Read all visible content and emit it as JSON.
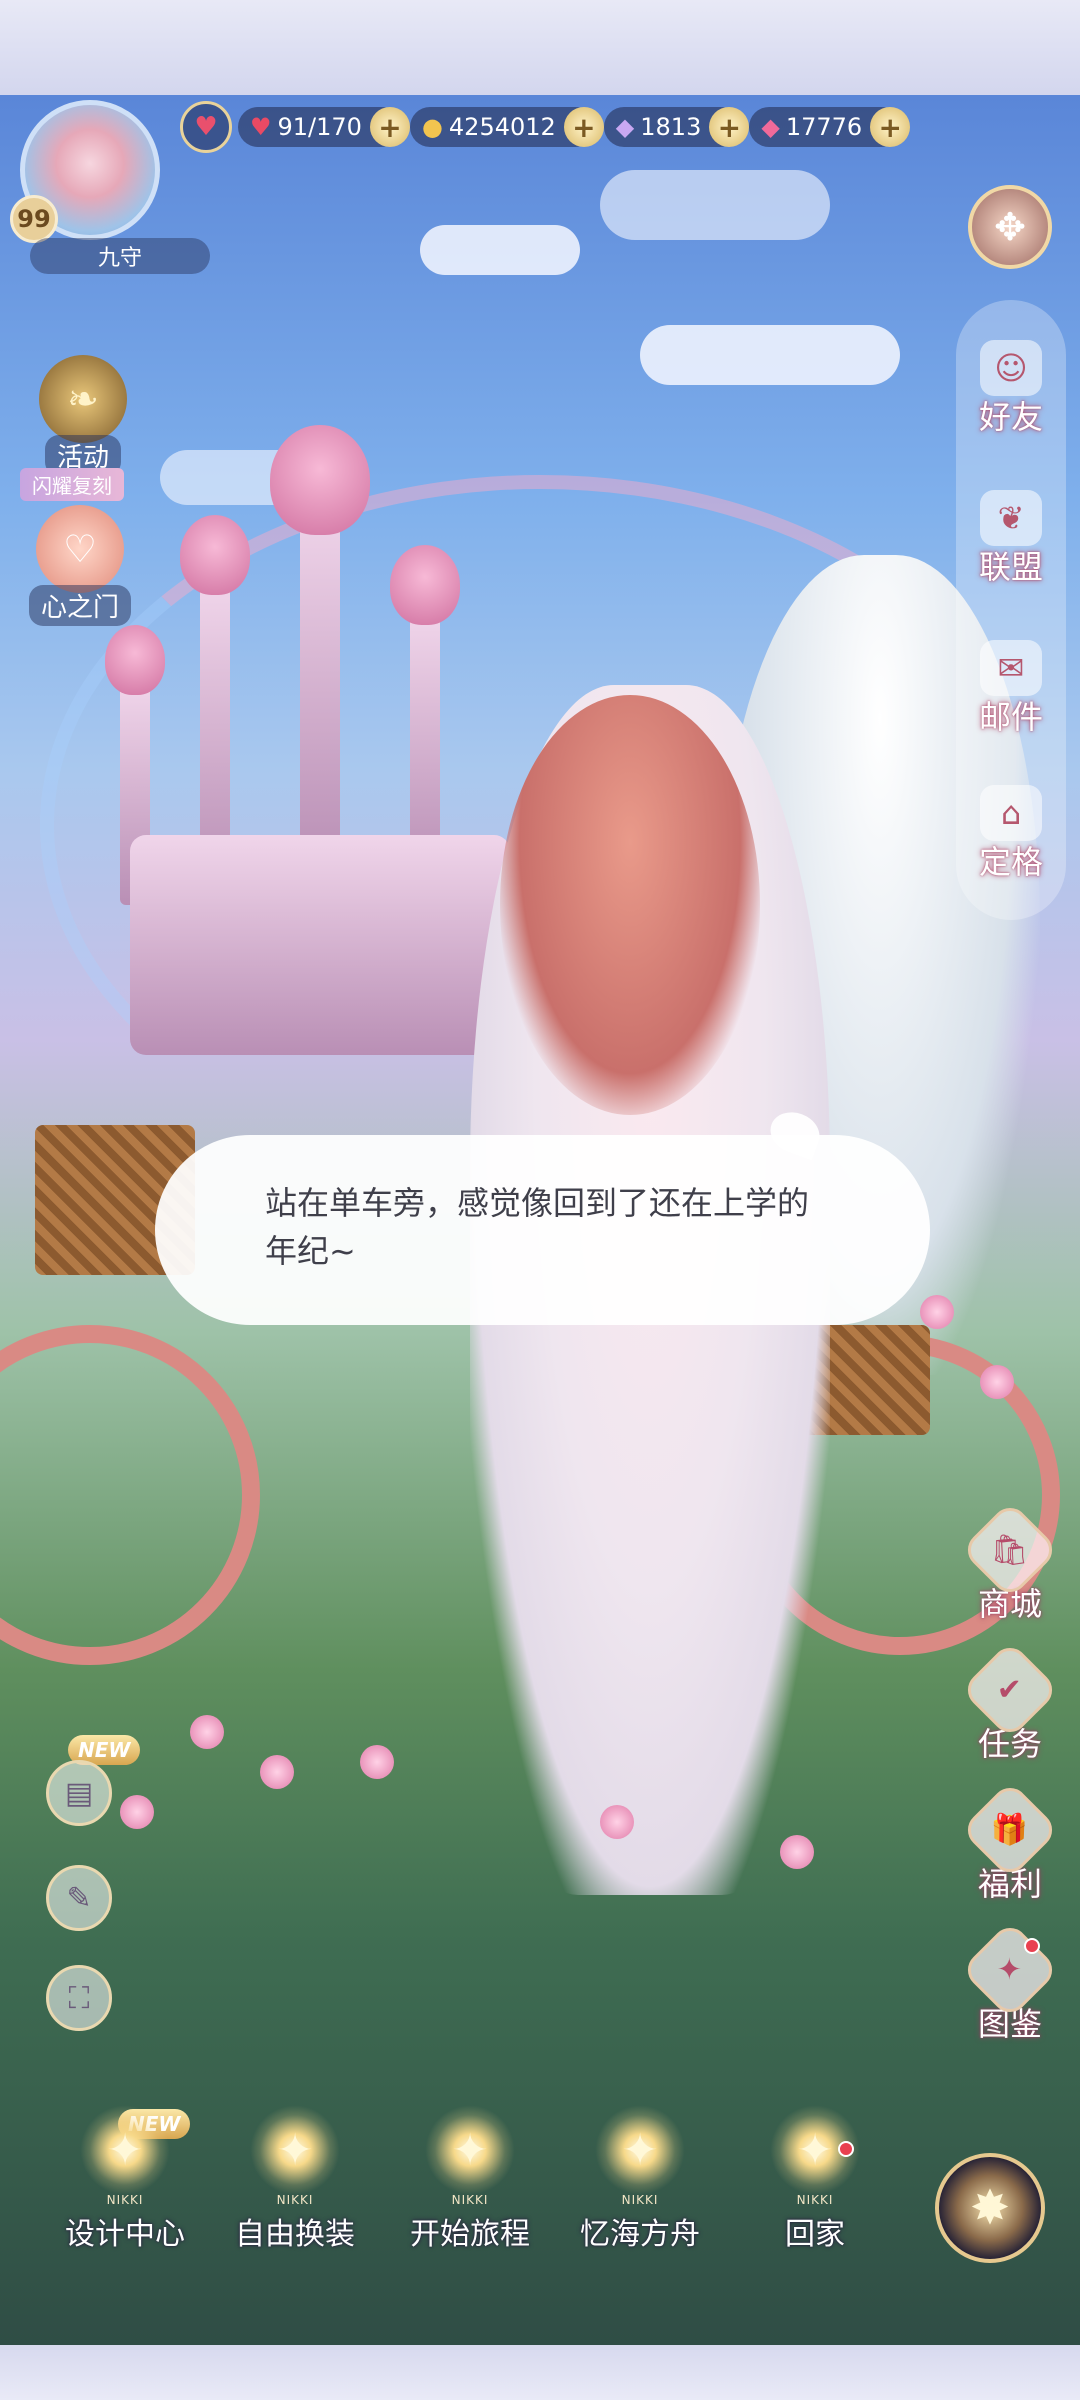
{
  "player": {
    "level": "99",
    "name": "九守"
  },
  "resources": {
    "stamina": "91/170",
    "gold": "4254012",
    "diamonds": "1813",
    "stars": "17776",
    "plus": "+"
  },
  "left_events": {
    "activity": "活动",
    "flash_tag": "闪耀复刻",
    "heart_gate": "心之门"
  },
  "right_menu": {
    "friends": "好友",
    "alliance": "联盟",
    "mail": "邮件",
    "pose": "定格"
  },
  "right_shop": {
    "mall": "商城",
    "tasks": "任务",
    "benefits": "福利",
    "album": "图鉴"
  },
  "badges": {
    "new": "NEW"
  },
  "speech": {
    "text": "站在单车旁，感觉像回到了还在上学的年纪~"
  },
  "bottom_nav": {
    "brand": "NIKKI",
    "design_center": "设计中心",
    "free_dress": "自由换装",
    "start_journey": "开始旅程",
    "memory_ark": "忆海方舟",
    "go_home": "回家"
  },
  "colors": {
    "accent_gold": "#e9d39a",
    "label_glow": "#b04a6a",
    "red_dot": "#e94050"
  }
}
